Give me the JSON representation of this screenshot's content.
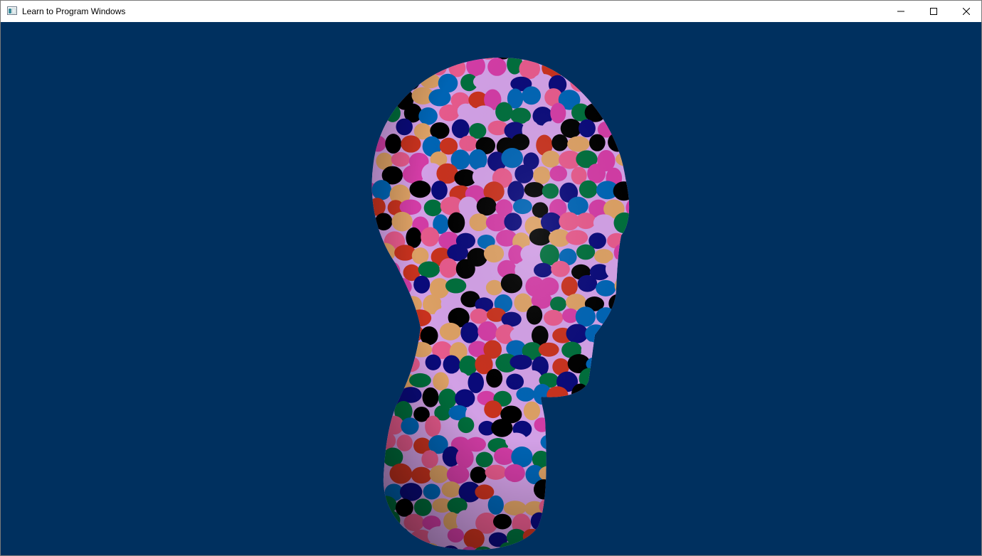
{
  "window": {
    "title": "Learn to Program Windows",
    "client_background": "#00305f"
  },
  "icons": {
    "app": "window-app-icon",
    "minimize": "minimize-icon",
    "maximize": "maximize-icon",
    "close": "close-icon"
  },
  "scene": {
    "object": "3d-textured-head-model",
    "patch_colors": [
      "#000000",
      "#0a0a7a",
      "#0064b4",
      "#d23ca5",
      "#e65a8c",
      "#d2a0e6",
      "#dca064",
      "#c8321e",
      "#006e3c"
    ]
  }
}
